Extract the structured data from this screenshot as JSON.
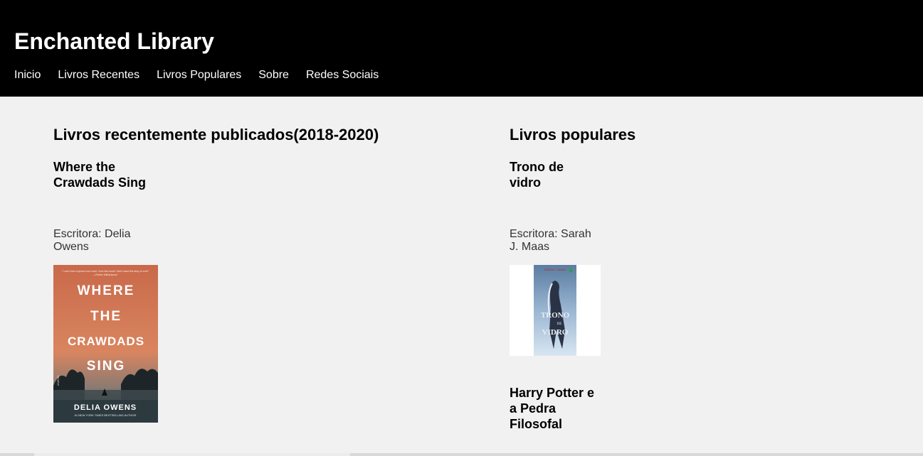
{
  "header": {
    "title": "Enchanted Library",
    "nav": [
      "Inicio",
      "Livros Recentes",
      "Livros Populares",
      "Sobre",
      "Redes Sociais"
    ]
  },
  "recent": {
    "heading": "Livros recentemente publicados(2018-2020)",
    "books": [
      {
        "title_line1": "Where the",
        "title_line2": "Crawdads Sing",
        "author_line1": "Escritora: Delia",
        "author_line2": "Owens",
        "cover": {
          "blurb_line1": "\"I can't even express how much I love this book! I didn't want this story to end!\"",
          "blurb_line2": "—Reese Witherspoon",
          "word1": "WHERE",
          "word2": "THE",
          "word3": "CRAWDADS",
          "word4": "SING",
          "side": "A NOVEL",
          "author": "DELIA OWENS",
          "tag": "#1 NEW YORK TIMES BESTSELLING AUTHOR"
        }
      }
    ]
  },
  "popular": {
    "heading": "Livros populares",
    "books": [
      {
        "title_line1": "Trono de",
        "title_line2": "vidro",
        "author_line1": "Escritora: Sarah",
        "author_line2": "J. Maas",
        "cover": {
          "top": "SARAH J. MAAS",
          "word1": "TRONO",
          "word2": "DE",
          "word3": "VIDRO"
        }
      },
      {
        "title_line1": "Harry Potter e",
        "title_line2": "a Pedra",
        "title_line3": "Filosofal"
      }
    ]
  },
  "colors": {
    "header_bg": "#000000",
    "page_bg": "#f1f1f1",
    "cover1_top": "#d07a56",
    "cover1_bottom": "#2c3a40"
  }
}
